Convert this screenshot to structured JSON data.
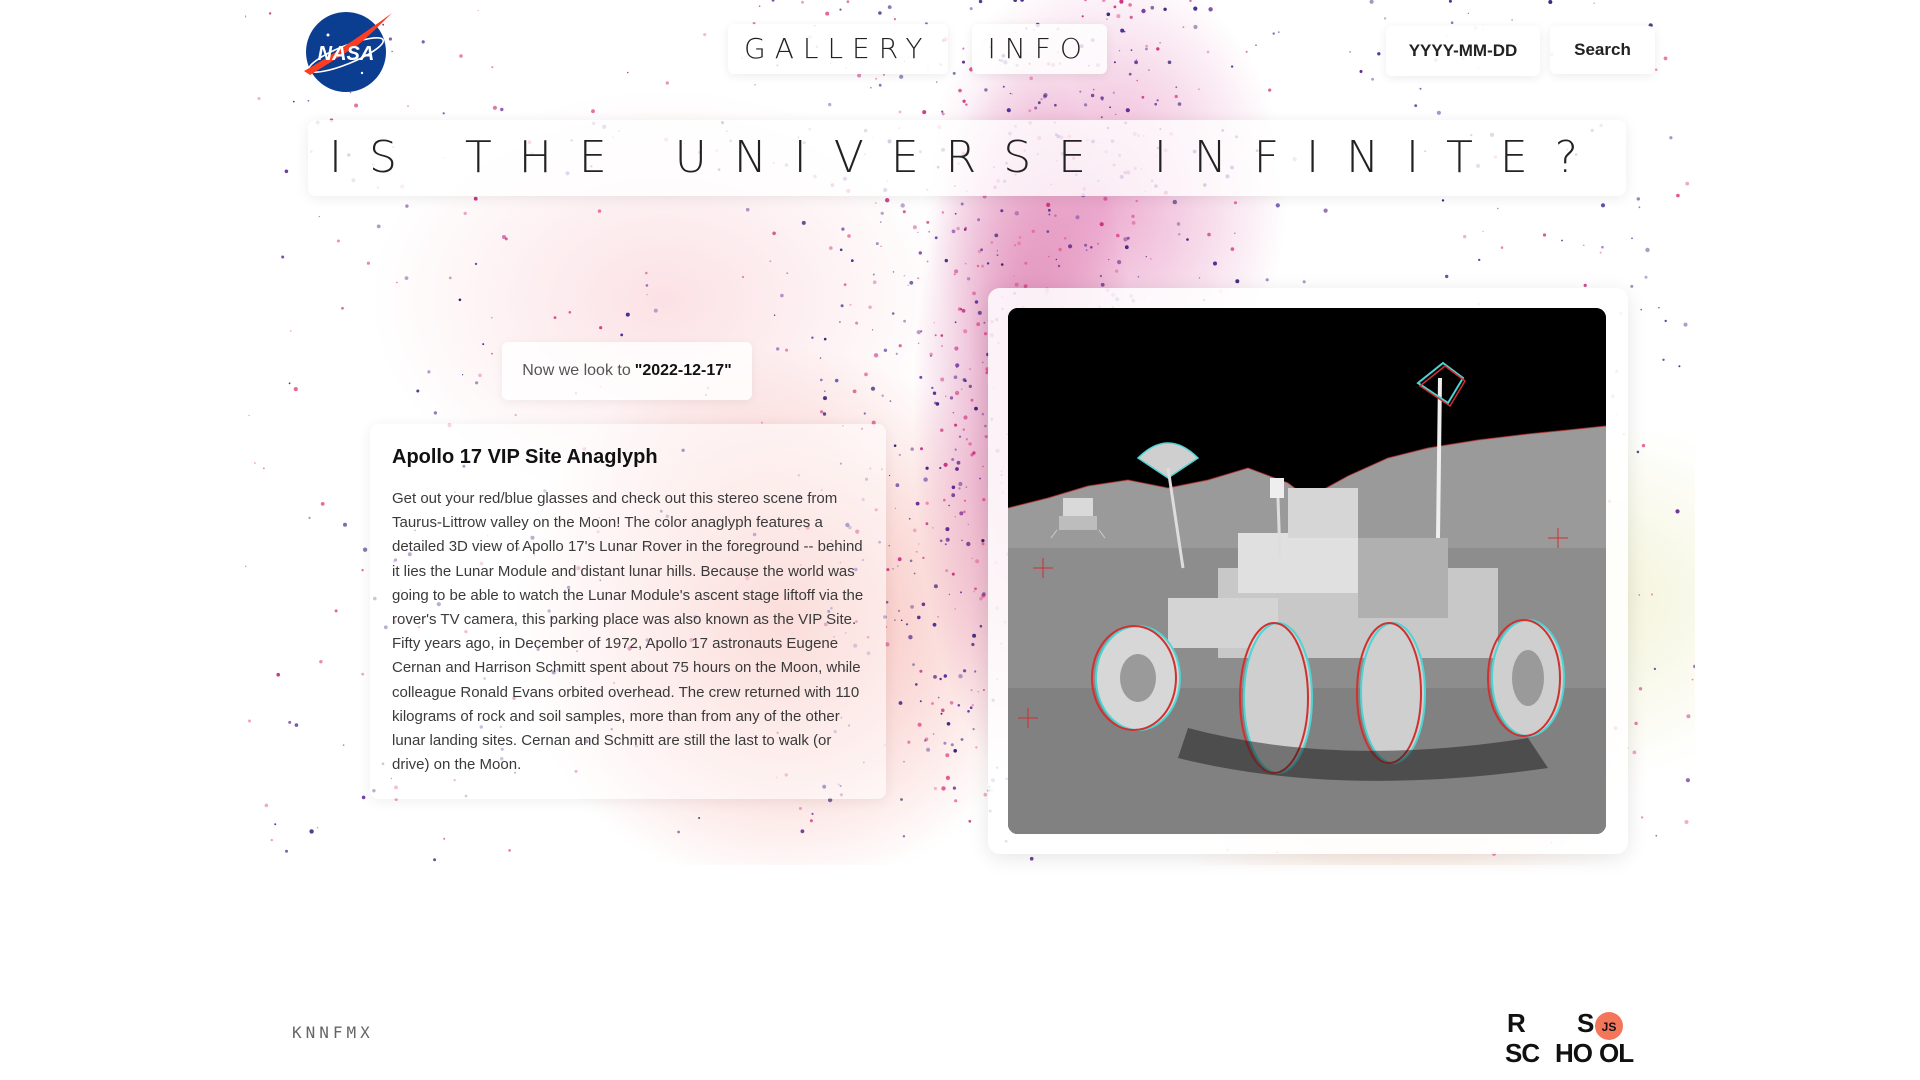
{
  "header": {
    "logo_text": "NASA",
    "nav": [
      "GALLERY",
      "INFO"
    ],
    "search": {
      "placeholder": "YYYY-MM-DD",
      "button_label": "Search"
    }
  },
  "hero": {
    "title": "IS THE UNIVERSE INFINITE?"
  },
  "selected_date": {
    "prefix": "Now we look to",
    "value": "\"2022-12-17\""
  },
  "apod": {
    "title": "Apollo 17 VIP Site Anaglyph",
    "explanation": "Get out your red/blue glasses and check out this stereo scene from Taurus-Littrow valley on the Moon! The color anaglyph features a detailed 3D view of Apollo 17's Lunar Rover in the foreground -- behind it lies the Lunar Module and distant lunar hills. Because the world was going to be able to watch the Lunar Module's ascent stage liftoff via the rover's TV camera, this parking place was also known as the VIP Site. Fifty years ago, in December of 1972, Apollo 17 astronauts Eugene Cernan and Harrison Schmitt spent about 75 hours on the Moon, while colleague Ronald Evans orbited overhead. The crew returned with 110 kilograms of rock and soil samples, more than from any of the other lunar landing sites. Cernan and Schmitt are still the last to walk (or drive) on the Moon."
  },
  "footer": {
    "author": "KNNFMX",
    "school_logo": {
      "line1": [
        "R",
        "S"
      ],
      "line2": [
        "SC",
        "HO",
        "OL"
      ],
      "badge": "JS"
    }
  },
  "colors": {
    "accent": "#c8287a",
    "nasa_blue": "#0b3d91",
    "nasa_red": "#fc3d21",
    "school_badge": "#f4765a"
  },
  "icons": {
    "logo": "nasa-meatball-logo",
    "school": "rs-school-logo"
  }
}
